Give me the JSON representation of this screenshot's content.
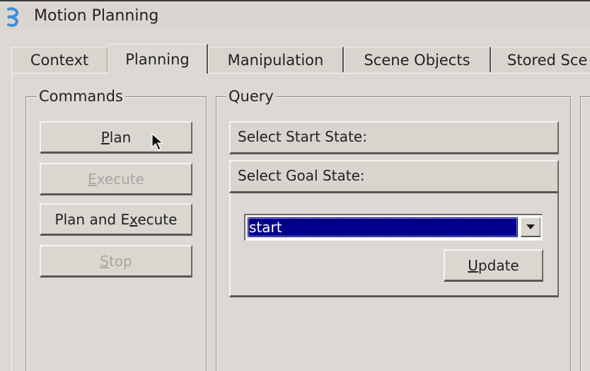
{
  "window": {
    "title": "Motion Planning",
    "icon": "rviz-icon"
  },
  "tabs": [
    {
      "label": "Context",
      "active": false
    },
    {
      "label": "Planning",
      "active": true
    },
    {
      "label": "Manipulation",
      "active": false
    },
    {
      "label": "Scene Objects",
      "active": false
    },
    {
      "label": "Stored Sce",
      "active": false
    }
  ],
  "commands": {
    "title": "Commands",
    "plan": {
      "before": "",
      "mnemonic": "P",
      "after": "lan",
      "enabled": true
    },
    "execute": {
      "before": "",
      "mnemonic": "E",
      "after": "xecute",
      "enabled": false
    },
    "plan_and_execute": {
      "before": "Plan and E",
      "mnemonic": "x",
      "after": "ecute",
      "enabled": true
    },
    "stop": {
      "before": "",
      "mnemonic": "S",
      "after": "top",
      "enabled": false
    }
  },
  "query": {
    "title": "Query",
    "select_start_state": "Select Start State:",
    "select_goal_state": "Select Goal State:",
    "goal_state_value": "start",
    "update": {
      "before": "",
      "mnemonic": "U",
      "after": "pdate"
    }
  },
  "colors": {
    "selection": "#00008b",
    "window_bg": "#dcd9d4",
    "disabled_text": "#a9a6a1"
  }
}
